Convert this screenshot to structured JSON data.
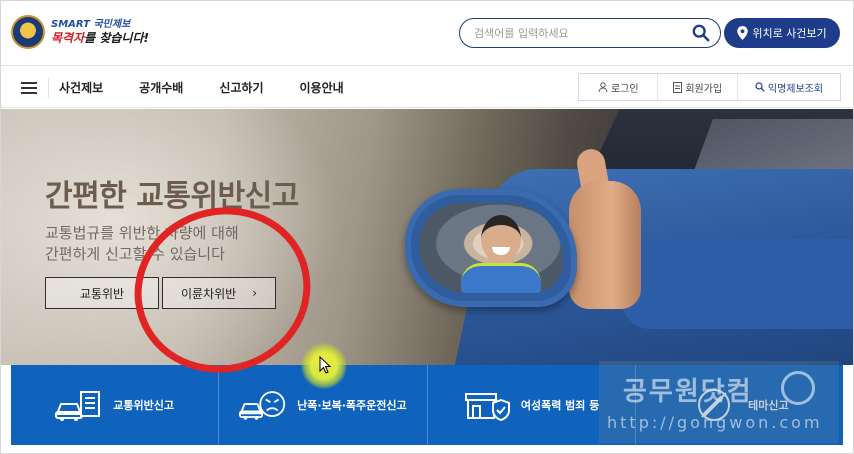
{
  "header": {
    "logo_top": "SMART 국민제보",
    "logo_bottom_em": "목격자",
    "logo_bottom_rest": "를 찾습니다!",
    "search_placeholder": "검색어를 입력하세요",
    "location_button": "위치로 사건보기"
  },
  "nav": {
    "items": [
      "사건제보",
      "공개수배",
      "신고하기",
      "이용안내"
    ],
    "util": [
      "로그인",
      "회원가입",
      "익명제보조회"
    ]
  },
  "hero": {
    "title": "간편한 교통위반신고",
    "subtitle_line1": "교통법규를 위반한 차량에 대해",
    "subtitle_line2": "간편하게 신고할 수 있습니다",
    "button1": "교통위반",
    "button2": "이륜차위반",
    "button2_arrow": "›"
  },
  "quick_menu": [
    {
      "label": "교통위반신고",
      "icon": "car-document-icon"
    },
    {
      "label": "난폭·보복·폭주운전신고",
      "icon": "angry-car-icon"
    },
    {
      "label": "여성폭력 범죄 등",
      "icon": "store-shield-icon"
    },
    {
      "label": "테마신고",
      "icon": "syringe-icon"
    }
  ],
  "watermark": {
    "text": "공무원닷컴",
    "url": "http://gongwon.com"
  },
  "colors": {
    "brand_navy": "#1f3c8a",
    "quick_blue": "#0f63bd",
    "annotation_red": "#e02424"
  }
}
